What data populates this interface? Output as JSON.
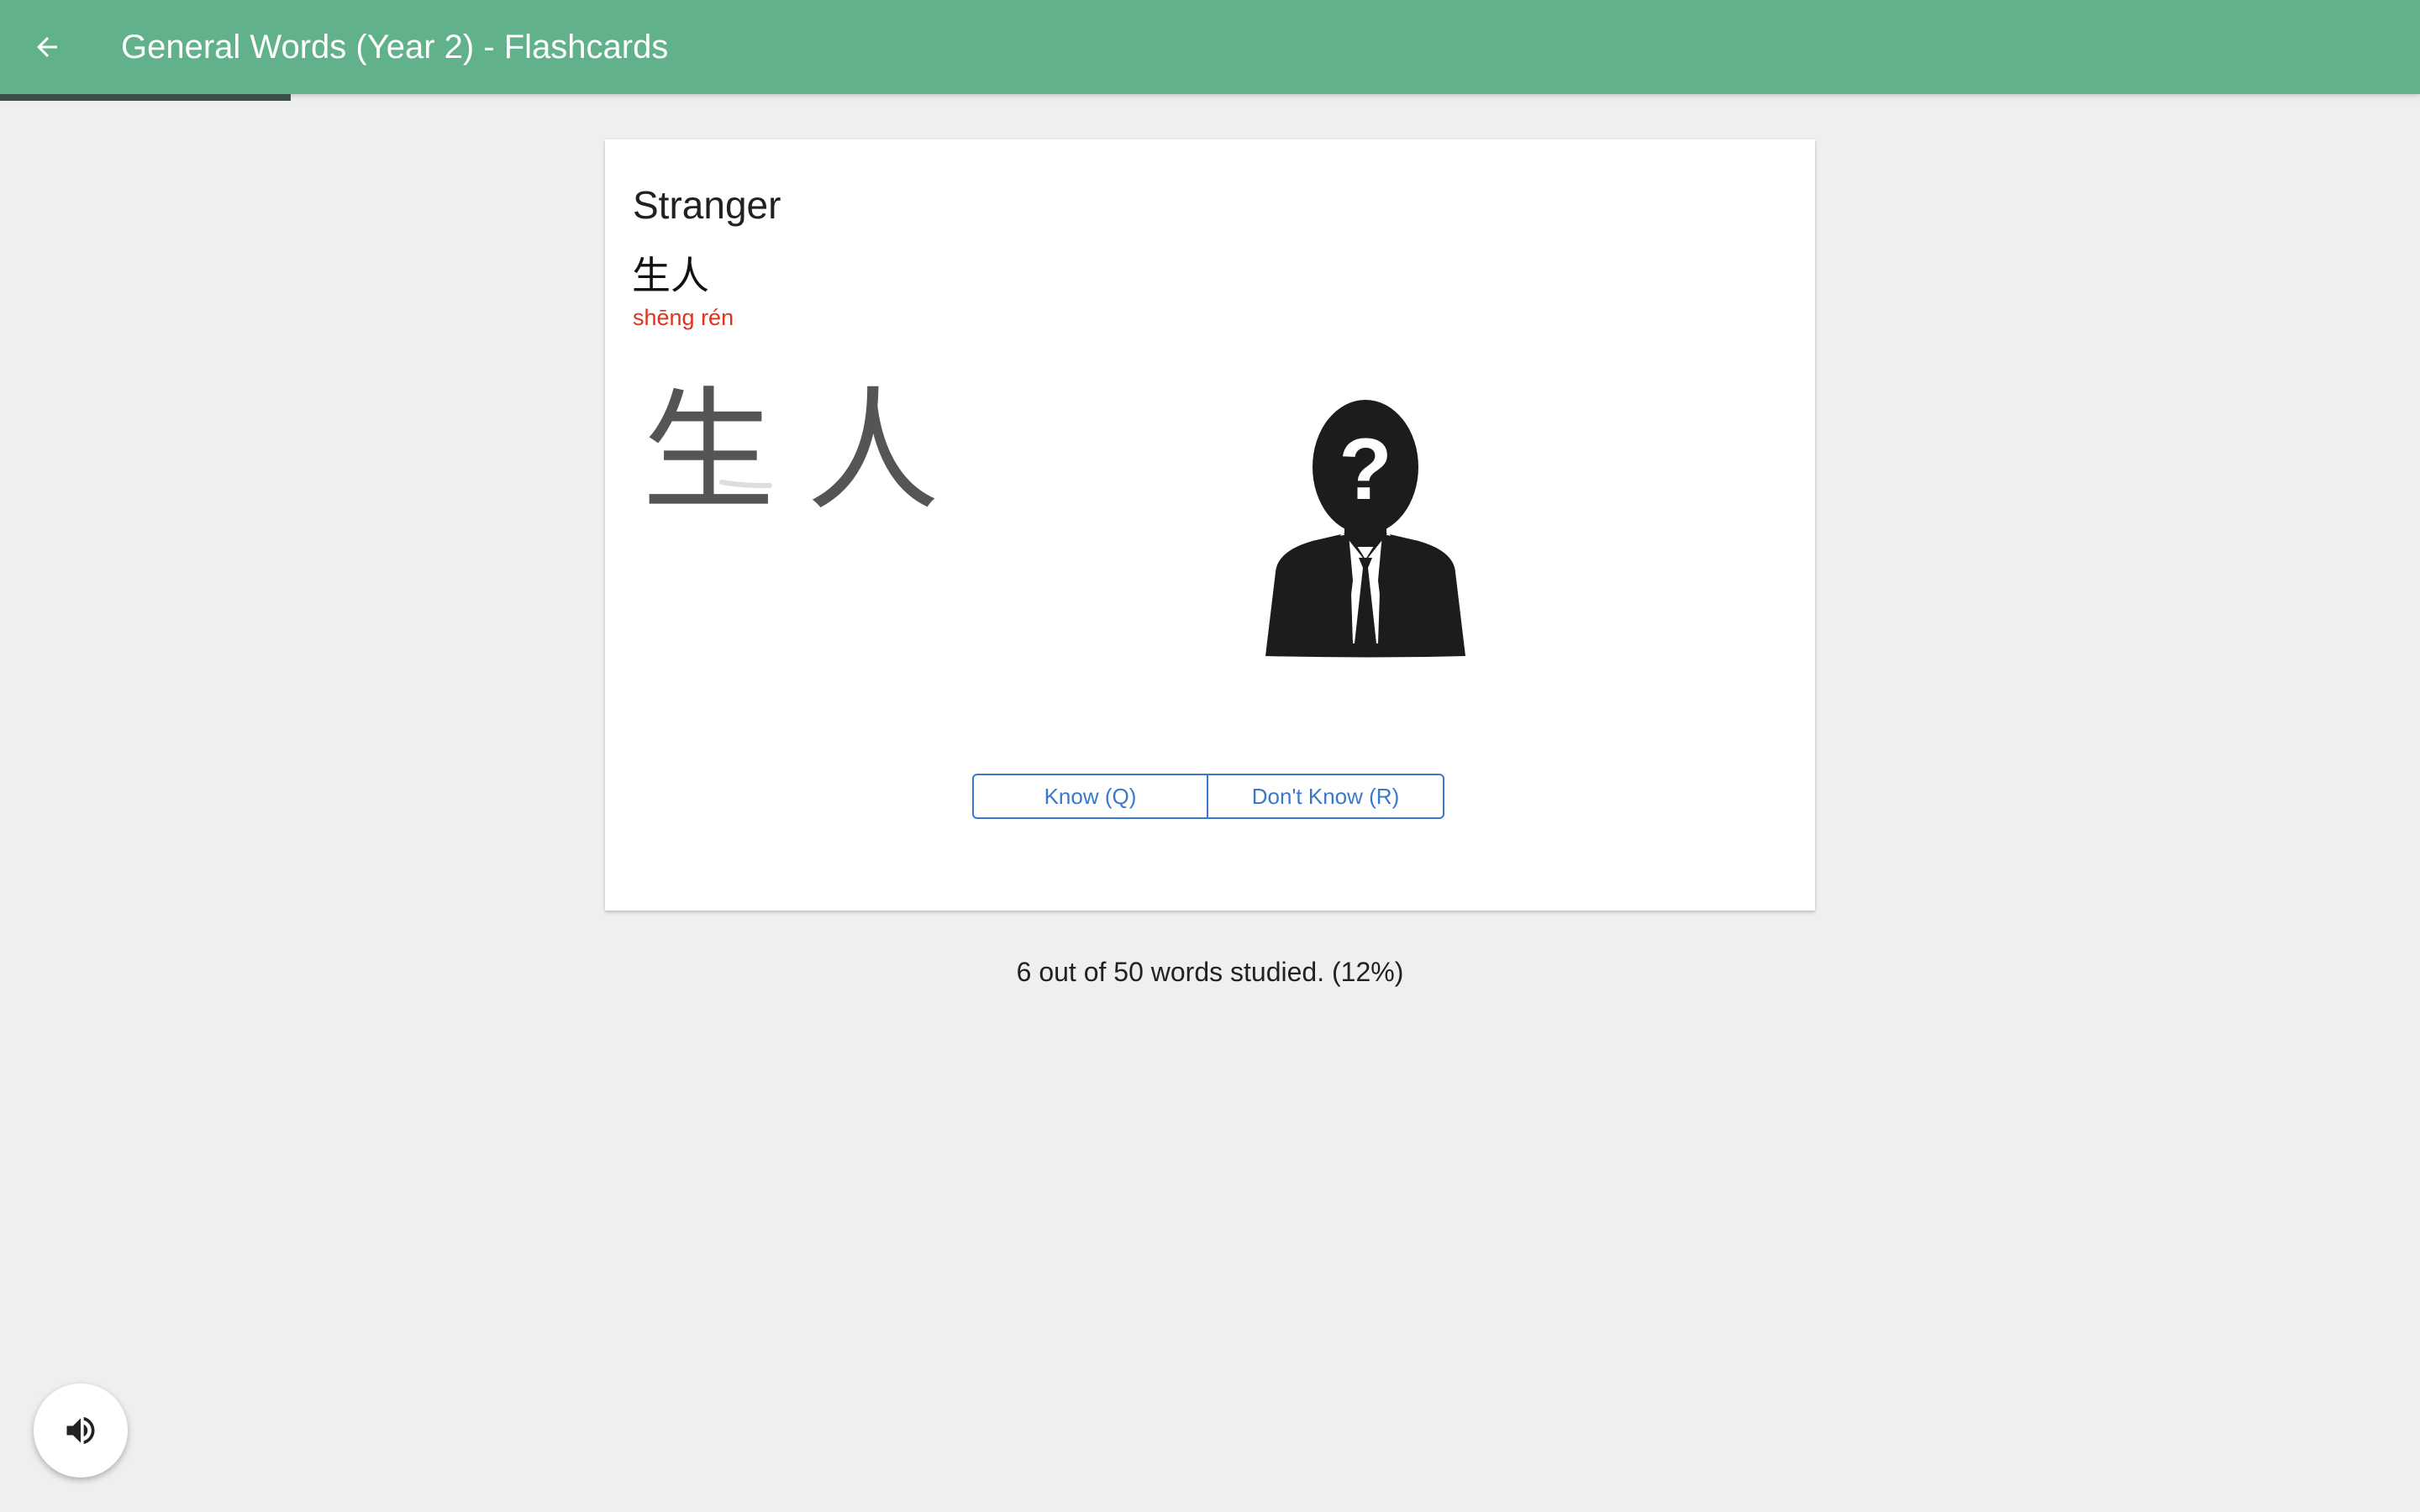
{
  "appbar": {
    "title": "General Words (Year 2) - Flashcards",
    "background_color": "#61b28b",
    "back_icon": "arrow-left-icon"
  },
  "progress": {
    "studied": 6,
    "total": 50,
    "percent": 12,
    "bar_color": "#3d4f49"
  },
  "card": {
    "english": "Stranger",
    "chinese": "生人",
    "pinyin": "shēng rén",
    "pinyin_color": "#e0311c",
    "stroke_characters": [
      "生",
      "人"
    ],
    "illustration_icon": "unknown-person-icon"
  },
  "buttons": {
    "know_label": "Know (Q)",
    "dont_know_label": "Don't Know (R)",
    "accent_color": "#3a78c9"
  },
  "status": {
    "text": "6 out of 50 words studied. (12%)"
  },
  "audio": {
    "icon": "speaker-icon"
  }
}
